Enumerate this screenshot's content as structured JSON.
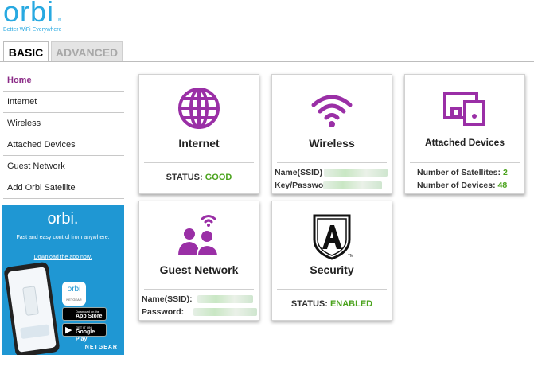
{
  "logo": {
    "word": "orbi",
    "tm": "TM",
    "tagline": "Better WiFi Everywhere"
  },
  "tabs": [
    {
      "label": "BASIC",
      "active": true
    },
    {
      "label": "ADVANCED",
      "active": false
    }
  ],
  "sidebar": {
    "items": [
      {
        "label": "Home",
        "active": true
      },
      {
        "label": "Internet"
      },
      {
        "label": "Wireless"
      },
      {
        "label": "Attached Devices"
      },
      {
        "label": "Guest Network"
      },
      {
        "label": "Add Orbi Satellite"
      }
    ]
  },
  "promo": {
    "logo": "orbi.",
    "text": "Fast and easy control from anywhere.",
    "link": "Download the app now.",
    "badge_word": "orbi",
    "badge_sub": "NETGEAR",
    "app_store_small": "Download on the",
    "app_store": "App Store",
    "google_play_small": "GET IT ON",
    "google_play": "Google Play",
    "brand": "NETGEAR"
  },
  "cards": {
    "internet": {
      "title": "Internet",
      "status_label": "STATUS:",
      "status_value": "GOOD"
    },
    "wireless": {
      "title": "Wireless",
      "ssid_label": "Name(SSID)",
      "key_label": "Key/Passwo"
    },
    "attached": {
      "title": "Attached Devices",
      "satellites_label": "Number of Satellites:",
      "satellites_value": "2",
      "devices_label": "Number of Devices:",
      "devices_value": "48"
    },
    "guest": {
      "title": "Guest Network",
      "ssid_label": "Name(SSID):",
      "password_label": "Password:"
    },
    "security": {
      "title": "Security",
      "status_label": "STATUS:",
      "status_value": "ENABLED",
      "tm": "TM"
    }
  },
  "colors": {
    "purple": "#8a2a86",
    "icon_purple": "#9a2fa6",
    "status_green": "#4aa31c",
    "brand_blue": "#28a9e1",
    "promo_blue": "#1f97d3"
  },
  "icons": [
    "globe-icon",
    "wifi-icon",
    "devices-icon",
    "guest-users-icon",
    "shield-a-icon",
    "apple-icon",
    "play-icon"
  ]
}
